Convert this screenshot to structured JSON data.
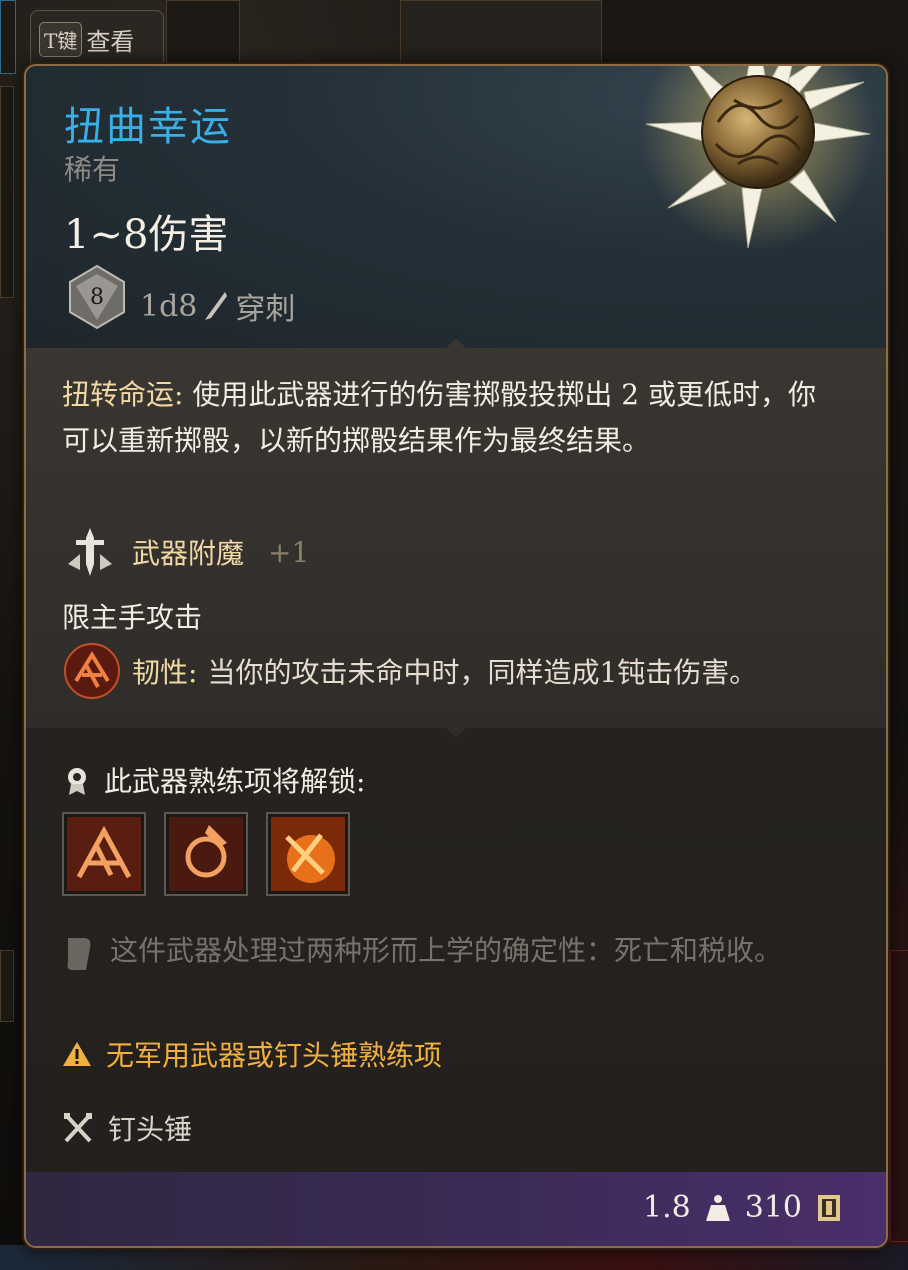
{
  "hint": {
    "key": "T键",
    "label": "查看"
  },
  "item": {
    "name": "扭曲幸运",
    "rarity": "稀有",
    "damage": "1~8伤害",
    "die_face": "8",
    "dice": "1d8",
    "damage_type": "穿刺"
  },
  "description": {
    "ability_name": "扭转命运:",
    "text": " 使用此武器进行的伤害掷骰投掷出 2 或更低时，你可以重新掷骰，以新的掷骰结果作为最终结果。",
    "enchant_name": "武器附魔",
    "enchant_value": "+1",
    "main_hand": "限主手攻击",
    "tough_name": "韧性:",
    "tough_text": " 当你的攻击未命中时，同样造成1钝击伤害。"
  },
  "proficiency": {
    "unlock_label": "此武器熟练项将解锁:",
    "icons": [
      "cleave-icon",
      "concussive-smash-icon",
      "heartstopper-icon"
    ]
  },
  "lore": "这件武器处理过两种形而上学的确定性：死亡和税收。",
  "warning": "无军用武器或钉头锤熟练项",
  "weapon_type": "钉头锤",
  "footer": {
    "weight": "1.8",
    "value": "310"
  },
  "colors": {
    "title": "#3aaee6",
    "highlight": "#f1d9a6",
    "warning": "#f0b040",
    "border": "#8d6b45"
  }
}
